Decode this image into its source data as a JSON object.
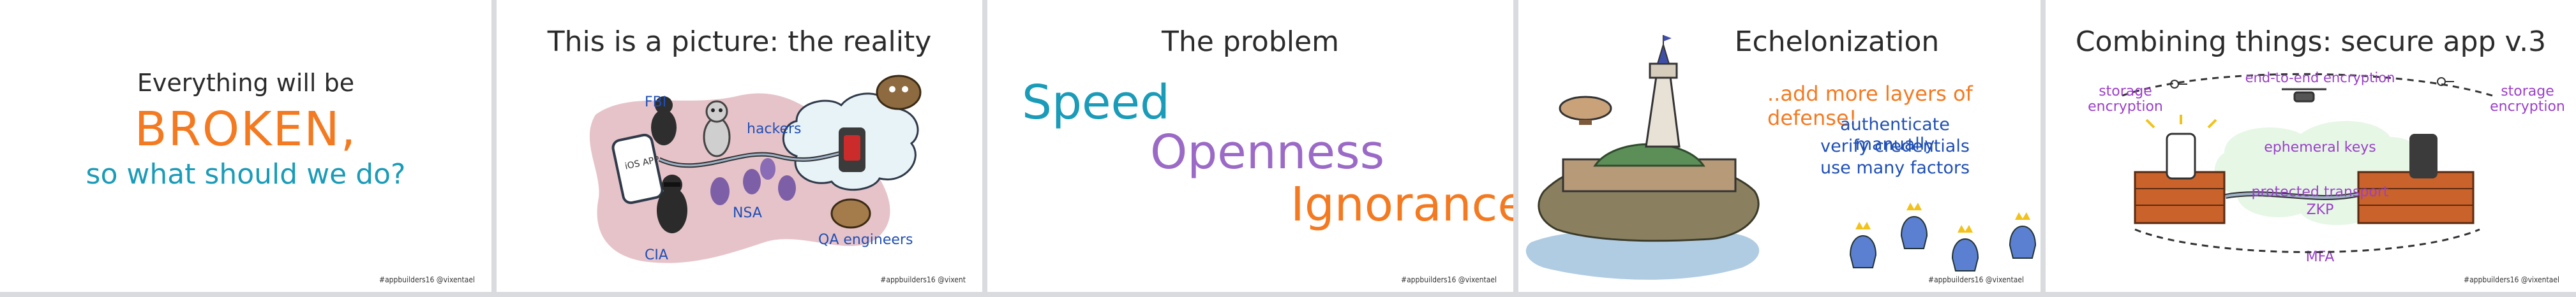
{
  "slides": [
    {
      "lines": [
        "Everything will be",
        "BROKEN,",
        "so what should we do?"
      ],
      "footer": "#appbuilders16 @vixentael"
    },
    {
      "title": "This is a picture: the reality",
      "labels": {
        "fbi": "FBI",
        "hackers": "hackers",
        "nsa": "NSA",
        "cia": "CIA",
        "qa": "QA engineers",
        "phone": "iOS APP"
      },
      "footer": "#appbuilders16 @vixent"
    },
    {
      "title": "The problem",
      "words": [
        "Speed",
        "Openness",
        "Ignorance"
      ],
      "footer": "#appbuilders16 @vixentael"
    },
    {
      "title": "Echelonization",
      "defense": "..add more layers of defense!",
      "bullets": [
        "authenticate manually",
        "verify credentials",
        "use many factors"
      ],
      "footer": "#appbuilders16 @vixentael"
    },
    {
      "title": "Combining things: secure app v.3",
      "labels": {
        "storage_left": "storage encryption",
        "e2e": "end-to-end encryption",
        "storage_right": "storage encryption",
        "ephemeral": "ephemeral keys",
        "protected": "protected transport",
        "zkp": "ZKP",
        "mfa": "MFA"
      },
      "footer": "#appbuilders16 @vixentael"
    }
  ],
  "colors": {
    "orange": "#f47a21",
    "teal": "#1a9bb8",
    "purple": "#9b6ac7",
    "blue": "#1f4fb5",
    "violet": "#9b3fc9"
  }
}
